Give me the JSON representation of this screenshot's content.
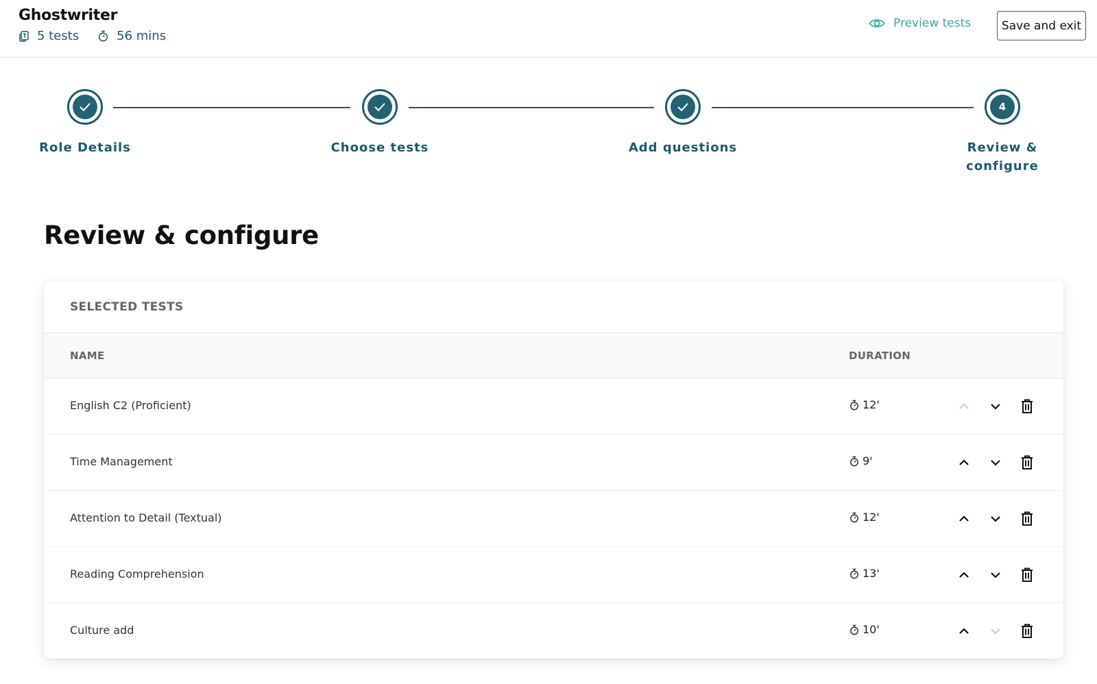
{
  "header": {
    "title": "Ghostwriter",
    "tests_count": "5 tests",
    "duration_total": "56 mins",
    "preview_label": "Preview tests",
    "save_label": "Save and exit",
    "icons": {
      "tests": "test-document-icon",
      "duration": "stopwatch-icon",
      "preview": "eye-icon"
    }
  },
  "stepper": {
    "steps": [
      {
        "label": "Role Details",
        "status": "completed"
      },
      {
        "label": "Choose tests",
        "status": "completed"
      },
      {
        "label": "Add questions",
        "status": "completed"
      },
      {
        "label": "Review & configure",
        "status": "current",
        "number": "4"
      }
    ]
  },
  "page": {
    "title": "Review & configure"
  },
  "selected_tests": {
    "title": "SELECTED TESTS",
    "columns": {
      "name": "NAME",
      "duration": "DURATION"
    },
    "rows": [
      {
        "name": "English C2 (Proficient)",
        "duration": "12'",
        "up_enabled": false,
        "down_enabled": true
      },
      {
        "name": "Time Management",
        "duration": "9'",
        "up_enabled": true,
        "down_enabled": true
      },
      {
        "name": "Attention to Detail (Textual)",
        "duration": "12'",
        "up_enabled": true,
        "down_enabled": true
      },
      {
        "name": "Reading Comprehension",
        "duration": "13'",
        "up_enabled": true,
        "down_enabled": true
      },
      {
        "name": "Culture add",
        "duration": "10'",
        "up_enabled": true,
        "down_enabled": false
      }
    ]
  },
  "colors": {
    "primary": "#1c5a6e",
    "accent": "#3aa89a",
    "disabled": "#cccccc"
  }
}
